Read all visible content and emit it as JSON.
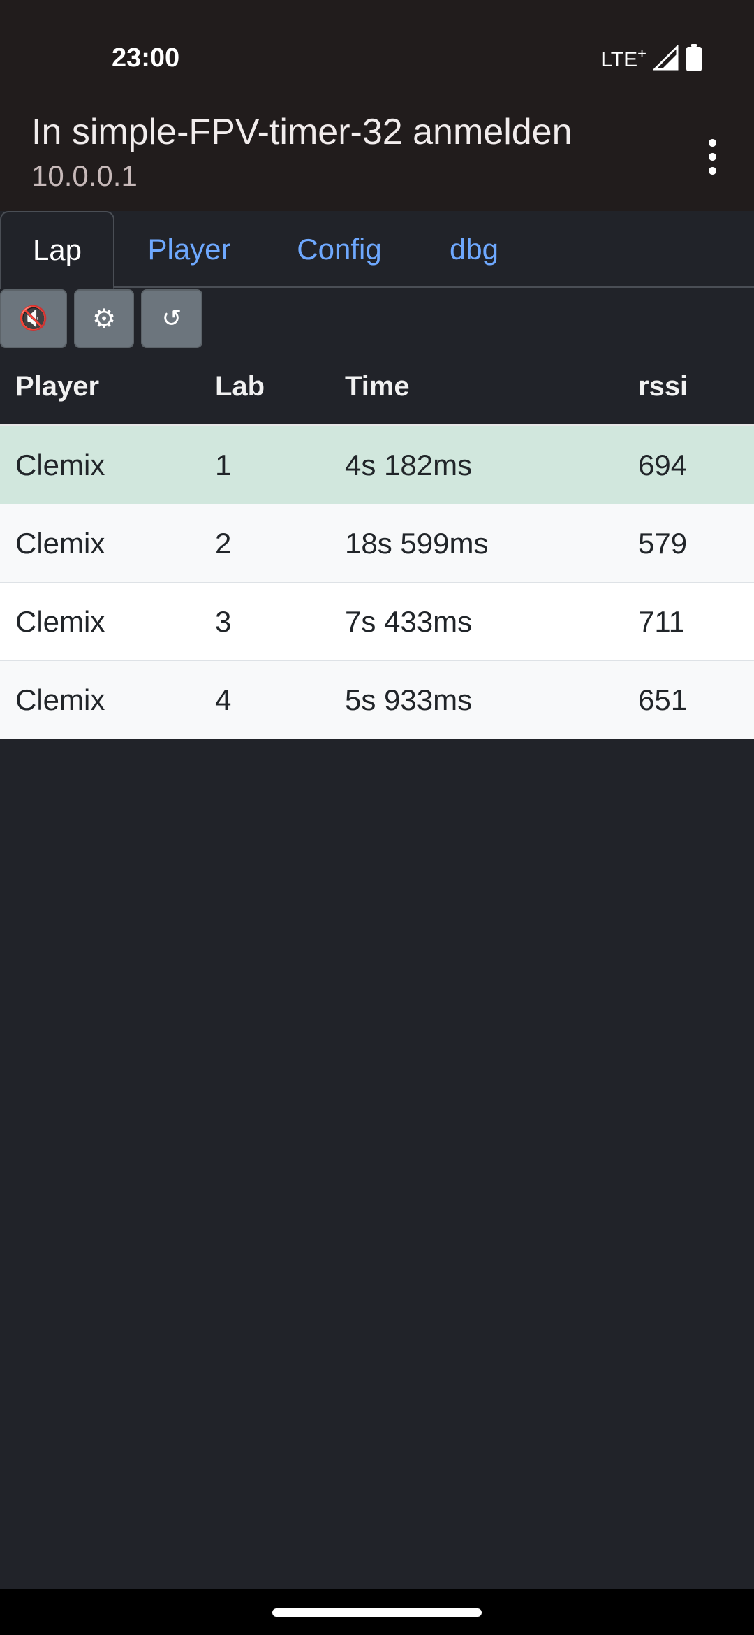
{
  "status_bar": {
    "time": "23:00",
    "network": "LTE",
    "network_plus": "+"
  },
  "app_bar": {
    "title": "In simple-FPV-timer-32 anmelden",
    "subtitle": "10.0.0.1"
  },
  "tabs": [
    {
      "label": "Lap",
      "active": true
    },
    {
      "label": "Player",
      "active": false
    },
    {
      "label": "Config",
      "active": false
    },
    {
      "label": "dbg",
      "active": false
    }
  ],
  "toolbar": {
    "mute_icon": "🔇",
    "settings_icon": "⚙",
    "reset_icon": "↺"
  },
  "table": {
    "headers": [
      "Player",
      "Lab",
      "Time",
      "rssi"
    ],
    "rows": [
      {
        "player": "Clemix",
        "lap": "1",
        "time": "4s 182ms",
        "rssi": "694"
      },
      {
        "player": "Clemix",
        "lap": "2",
        "time": "18s 599ms",
        "rssi": "579"
      },
      {
        "player": "Clemix",
        "lap": "3",
        "time": "7s 433ms",
        "rssi": "711"
      },
      {
        "player": "Clemix",
        "lap": "4",
        "time": "5s 933ms",
        "rssi": "651"
      }
    ]
  },
  "colors": {
    "background": "#212329",
    "header_bg": "#211c1c",
    "tab_link": "#6ea8fe",
    "highlight_row": "#d1e7dd",
    "button_bg": "#6c757d"
  }
}
